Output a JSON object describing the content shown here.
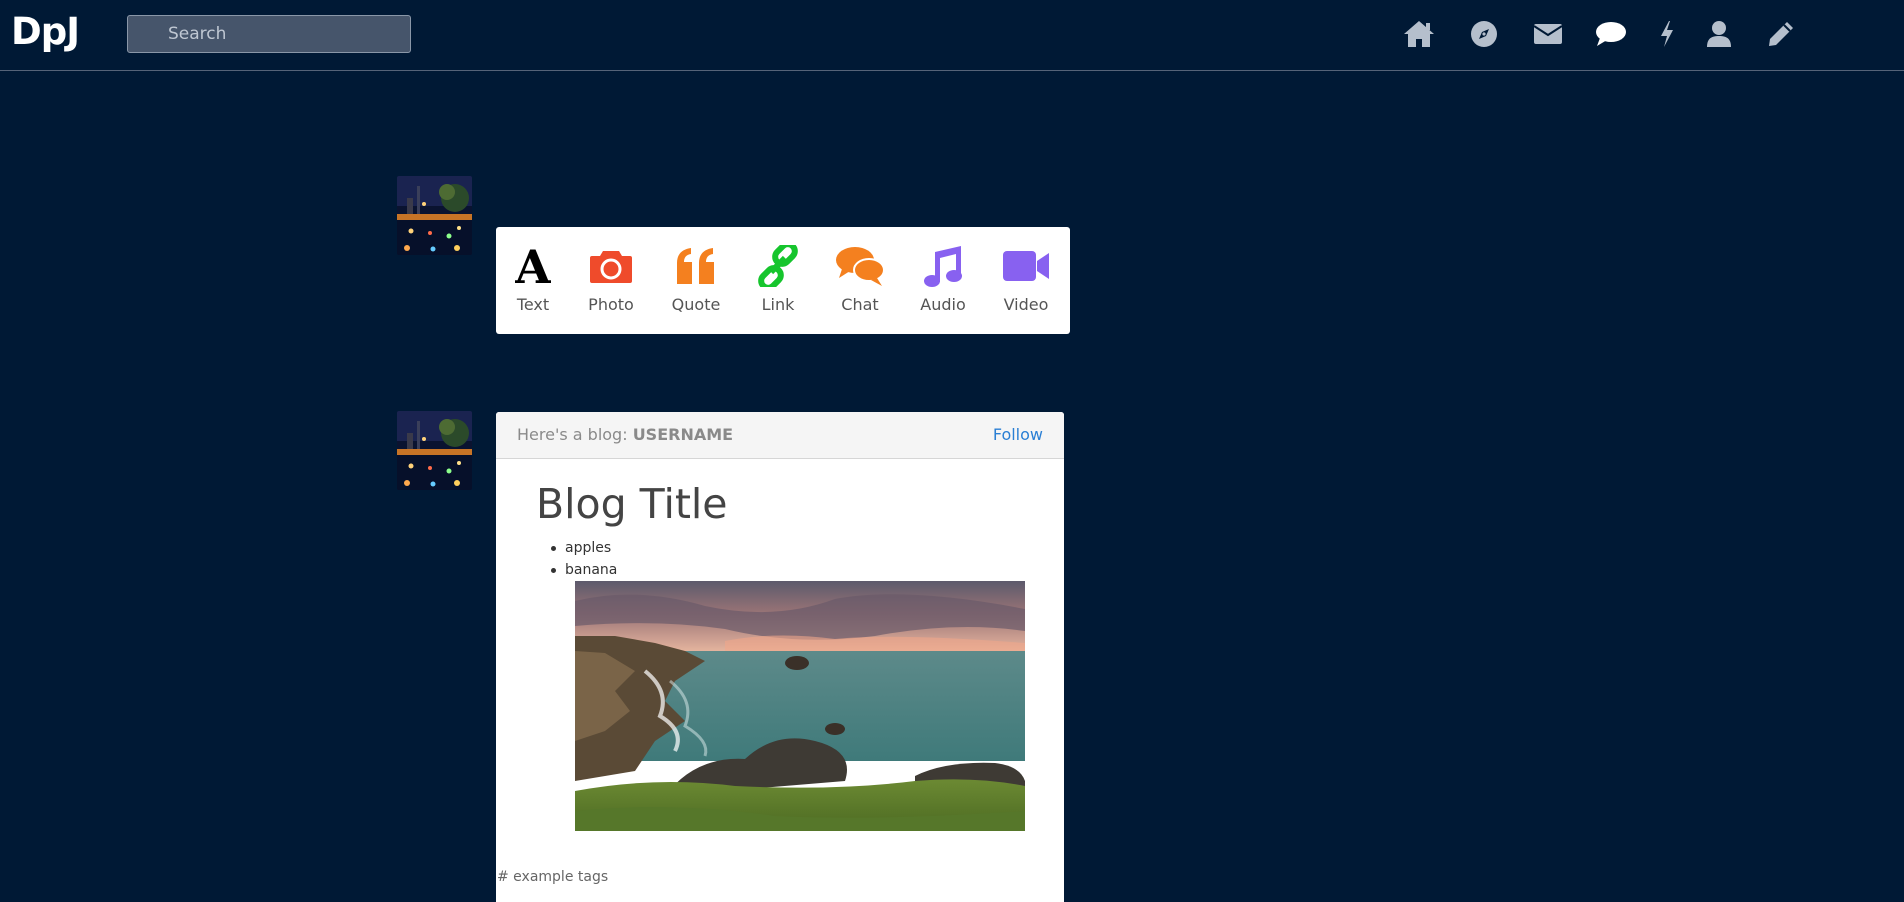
{
  "app": {
    "logo": "DpJ"
  },
  "search": {
    "placeholder": "Search"
  },
  "nav": {
    "icons": [
      "home-icon",
      "compass-icon",
      "envelope-icon",
      "chat-bubble-icon",
      "lightning-icon",
      "user-icon",
      "pencil-icon"
    ]
  },
  "post_types": [
    {
      "label": "Text",
      "icon": "text-icon",
      "color": "#000000"
    },
    {
      "label": "Photo",
      "icon": "camera-icon",
      "color": "#ef4b2b"
    },
    {
      "label": "Quote",
      "icon": "quote-icon",
      "color": "#f4801f"
    },
    {
      "label": "Link",
      "icon": "link-icon",
      "color": "#16c52d"
    },
    {
      "label": "Chat",
      "icon": "chat-icon",
      "color": "#f4801f"
    },
    {
      "label": "Audio",
      "icon": "music-note-icon",
      "color": "#8861f0"
    },
    {
      "label": "Video",
      "icon": "video-camera-icon",
      "color": "#8861f0"
    }
  ],
  "post": {
    "header_prefix": "Here's a blog:",
    "username": "USERNAME",
    "follow_label": "Follow",
    "title": "Blog Title",
    "list_items": [
      "apples",
      "banana"
    ],
    "tags": "# example tags"
  },
  "colors": {
    "background": "#001935",
    "accent_link": "#2a7fd4"
  }
}
